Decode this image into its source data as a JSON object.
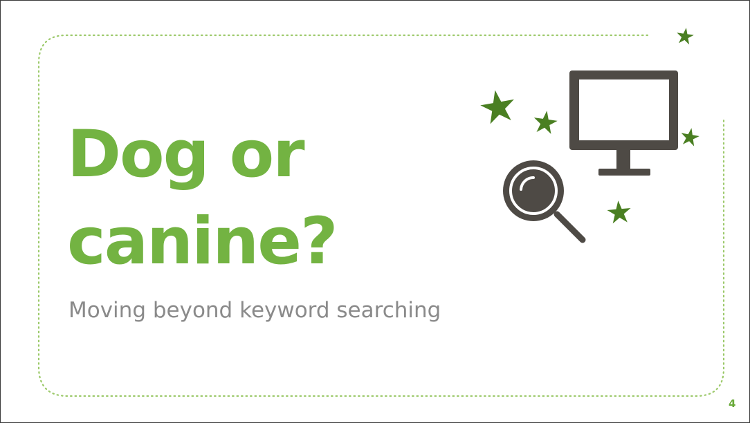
{
  "slide": {
    "title_line1": "Dog or",
    "title_line2": "canine?",
    "subtitle": "Moving beyond keyword searching",
    "page_number": "4"
  },
  "colors": {
    "title": "#73b342",
    "subtitle": "#8a8a8a",
    "star": "#4a7f22",
    "dotted_border": "#9cc96a",
    "icon_dark": "#4e4a45",
    "page_number": "#6aaa3a"
  },
  "icons": [
    "star-icon",
    "computer-monitor-icon",
    "magnifying-glass-icon"
  ]
}
